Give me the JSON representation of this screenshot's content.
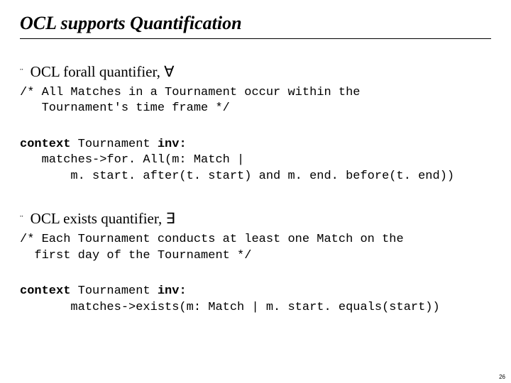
{
  "title": "OCL supports Quantification",
  "bullet1": {
    "glyph": "¨",
    "text_prefix": "OCL forall quantifier, ",
    "symbol": "∀"
  },
  "comment1_l1": "/* All Matches in a Tournament occur within the",
  "comment1_l2": "   Tournament's time frame */",
  "code1_l1_a": "context",
  "code1_l1_b": " Tournament ",
  "code1_l1_c": "inv:",
  "code1_l2": "   matches->for. All(m: Match |",
  "code1_l3": "       m. start. after(t. start) and m. end. before(t. end))",
  "bullet2": {
    "glyph": "¨",
    "text_prefix": "OCL exists quantifier, ",
    "symbol": "∃"
  },
  "comment2_l1": "/* Each Tournament conducts at least one Match on the",
  "comment2_l2": "  first day of the Tournament */",
  "code2_l1_a": "context",
  "code2_l1_b": " Tournament ",
  "code2_l1_c": "inv:",
  "code2_l2": "       matches->exists(m: Match | m. start. equals(start))",
  "page_number": "26"
}
